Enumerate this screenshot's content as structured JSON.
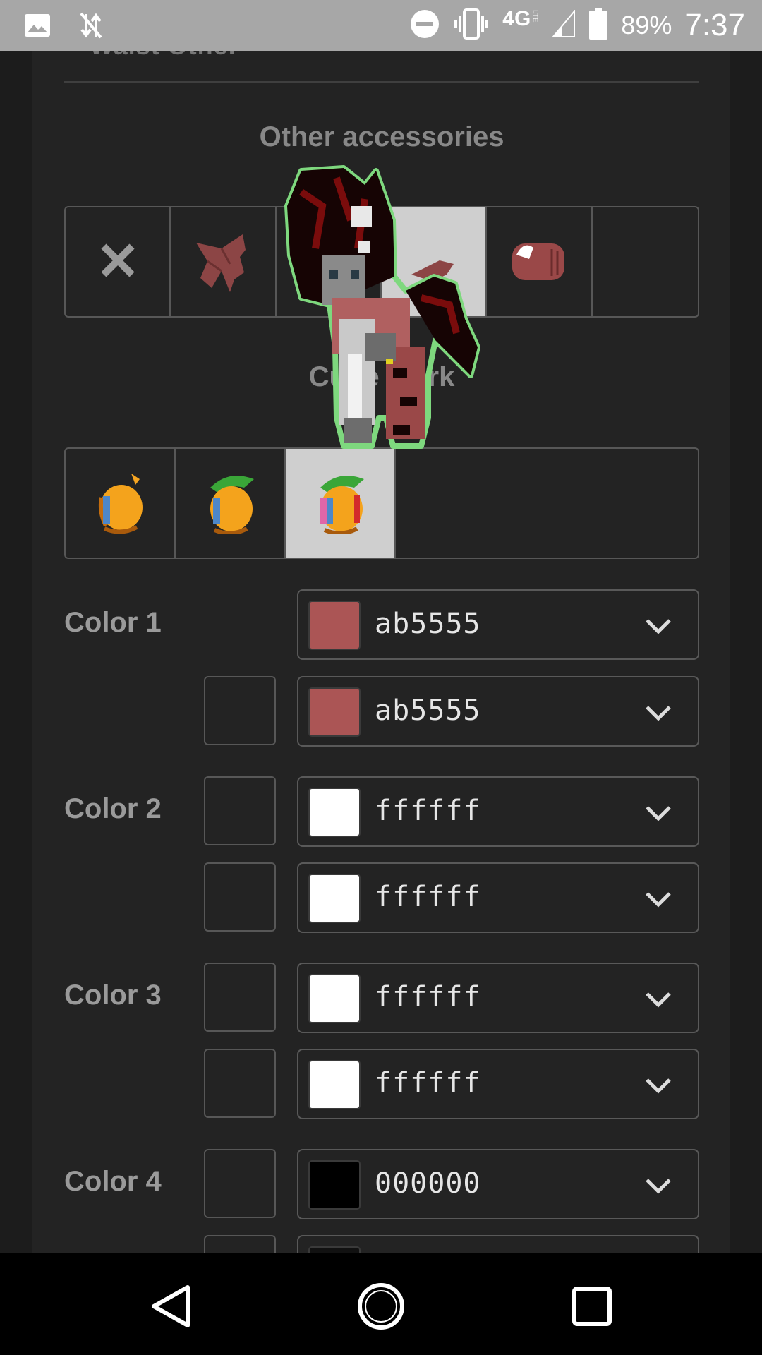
{
  "status_bar": {
    "battery": "89%",
    "time": "7:37",
    "network": "4G",
    "network_sub": "LTE",
    "icons": [
      "image-icon",
      "data-off-icon",
      "dnd-icon",
      "vibrate-icon",
      "network-4g-icon",
      "signal-icon",
      "battery-icon"
    ]
  },
  "tabs_partial": "Waist   Other",
  "accessories": {
    "title": "Other accessories",
    "tiles": [
      {
        "name": "none",
        "icon": "x-icon"
      },
      {
        "name": "wing-accessory",
        "icon": "wing-icon"
      },
      {
        "name": "accessory-3",
        "icon": "accessory-icon"
      },
      {
        "name": "accessory-4",
        "icon": "accessory-icon",
        "selected": true
      },
      {
        "name": "glove-accessory",
        "icon": "glove-icon"
      },
      {
        "name": "empty",
        "icon": ""
      }
    ]
  },
  "cutie_mark": {
    "title": "Cutie mark",
    "tiles": [
      {
        "name": "fruit-1",
        "icon": "fruit-icon"
      },
      {
        "name": "fruit-2",
        "icon": "fruit-leaf-icon"
      },
      {
        "name": "fruit-3",
        "icon": "fruit-rainbow-icon",
        "selected": true
      }
    ]
  },
  "colors": [
    {
      "label": "Color 1",
      "rows": [
        {
          "hex": "ab5555",
          "swatch": "#ab5555",
          "lock": false
        },
        {
          "hex": "ab5555",
          "swatch": "#ab5555",
          "lock": true
        }
      ]
    },
    {
      "label": "Color 2",
      "rows": [
        {
          "hex": "ffffff",
          "swatch": "#ffffff",
          "lock": true
        },
        {
          "hex": "ffffff",
          "swatch": "#ffffff",
          "lock": true
        }
      ]
    },
    {
      "label": "Color 3",
      "rows": [
        {
          "hex": "ffffff",
          "swatch": "#ffffff",
          "lock": true
        },
        {
          "hex": "ffffff",
          "swatch": "#ffffff",
          "lock": true
        }
      ]
    },
    {
      "label": "Color 4",
      "rows": [
        {
          "hex": "000000",
          "swatch": "#000000",
          "lock": true
        }
      ]
    }
  ],
  "nav": [
    "back-icon",
    "home-icon",
    "recents-icon"
  ]
}
